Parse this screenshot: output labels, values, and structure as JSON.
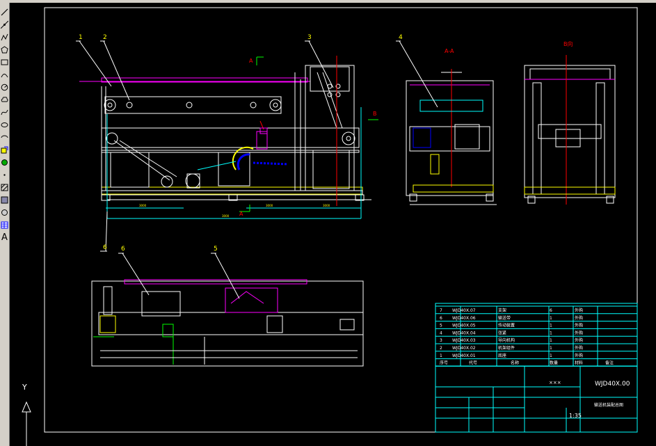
{
  "toolbar": {
    "tools": [
      {
        "name": "line-icon"
      },
      {
        "name": "construction-line-icon"
      },
      {
        "name": "polyline-icon"
      },
      {
        "name": "polygon-icon"
      },
      {
        "name": "rectangle-icon"
      },
      {
        "name": "arc-icon"
      },
      {
        "name": "circle-icon"
      },
      {
        "name": "revision-cloud-icon"
      },
      {
        "name": "spline-icon"
      },
      {
        "name": "ellipse-icon"
      },
      {
        "name": "ellipse-arc-icon"
      },
      {
        "name": "insert-block-icon"
      },
      {
        "name": "make-block-icon"
      },
      {
        "name": "point-icon"
      },
      {
        "name": "hatch-icon"
      },
      {
        "name": "gradient-icon"
      },
      {
        "name": "region-icon"
      },
      {
        "name": "table-icon"
      },
      {
        "name": "multiline-text-icon"
      }
    ],
    "text_tool_label": "A"
  },
  "colors": {
    "background": "#000000",
    "frame": "#ffffff",
    "line": "#ffffff",
    "magenta": "#ff00ff",
    "red": "#ff0000",
    "cyan": "#00ffff",
    "yellow": "#ffff00",
    "blue": "#0000ff",
    "green": "#00ff00"
  },
  "drawing": {
    "balloons": [
      "1",
      "2",
      "3",
      "4",
      "5",
      "6",
      "6"
    ],
    "view_labels": {
      "section": "A-A",
      "view_b": "B向",
      "mark_a": "A",
      "mark_b": "B"
    },
    "dimensions": [
      "3000",
      "3000",
      "3000",
      "3000"
    ],
    "scale": "1:35",
    "drawing_number": "WJD40X.00",
    "drawing_title": "输送机装配总图",
    "company": "×××",
    "bom": [
      {
        "no": "7",
        "code": "WJD40X.07",
        "name": "支架",
        "qty": "6",
        "note": "外购"
      },
      {
        "no": "6",
        "code": "WJD40X.06",
        "name": "输送带",
        "qty": "1",
        "note": "外购"
      },
      {
        "no": "5",
        "code": "WJD40X.05",
        "name": "传动装置",
        "qty": "1",
        "note": "外购"
      },
      {
        "no": "4",
        "code": "WJD40X.04",
        "name": "张紧",
        "qty": "1",
        "note": "外购"
      },
      {
        "no": "3",
        "code": "WJD40X.03",
        "name": "导向机构",
        "qty": "1",
        "note": "外购"
      },
      {
        "no": "2",
        "code": "WJD40X.02",
        "name": "机架组件",
        "qty": "1",
        "note": "外购"
      },
      {
        "no": "1",
        "code": "WJD40X.01",
        "name": "底座",
        "qty": "1",
        "note": "外购"
      }
    ],
    "bom_header": {
      "no": "序号",
      "code": "代号",
      "name": "名称",
      "qty": "数量",
      "material": "材料",
      "note": "备注"
    }
  },
  "ucs": {
    "y_label": "Y"
  }
}
